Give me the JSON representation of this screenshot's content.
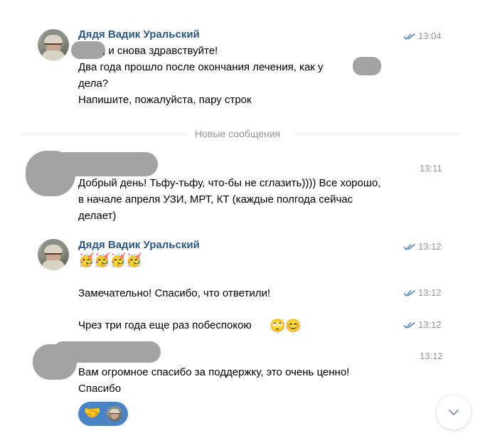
{
  "colors": {
    "name": "#2a5885",
    "time": "#939393",
    "check": "#5181b8",
    "redaction": "#a3a3a3",
    "reaction_bg": "#4a84c7"
  },
  "messages": {
    "m1": {
      "author": "Дядя Вадик Уральский",
      "time": "13:04",
      "line1": ", и снова здравствуйте!",
      "line2": "Два года прошло после окончания лечения, как у",
      "line3": "дела?",
      "line4": "Напишите, пожалуйста, пару строк"
    },
    "divider": "Новые сообщения",
    "m2": {
      "time": "13:11",
      "line1": "Добрый день! Тьфу-тьфу, что-бы не сглазить)))) Все хорошо,",
      "line2": "в начале апреля УЗИ, МРТ, КТ (каждые полгода сейчас",
      "line3": "делает)"
    },
    "m3": {
      "author": "Дядя Вадик Уральский",
      "time": "13:12",
      "emojis": "🥳🥳🥳🥳"
    },
    "m4": {
      "text": "Замечательно! Спасибо, что ответили!",
      "time": "13:12"
    },
    "m5": {
      "text": "Чрез три года еще раз побеспокою",
      "emojis": "🙄😊",
      "time": "13:12"
    },
    "m6": {
      "time": "13:12",
      "line1": "Вам огромное спасибо за поддержку, это очень ценно!",
      "line2": "Спасибо"
    },
    "reaction_emoji": "🤝"
  },
  "icons": {
    "check": "double-check-icon",
    "scroll": "chevron-down-icon"
  }
}
